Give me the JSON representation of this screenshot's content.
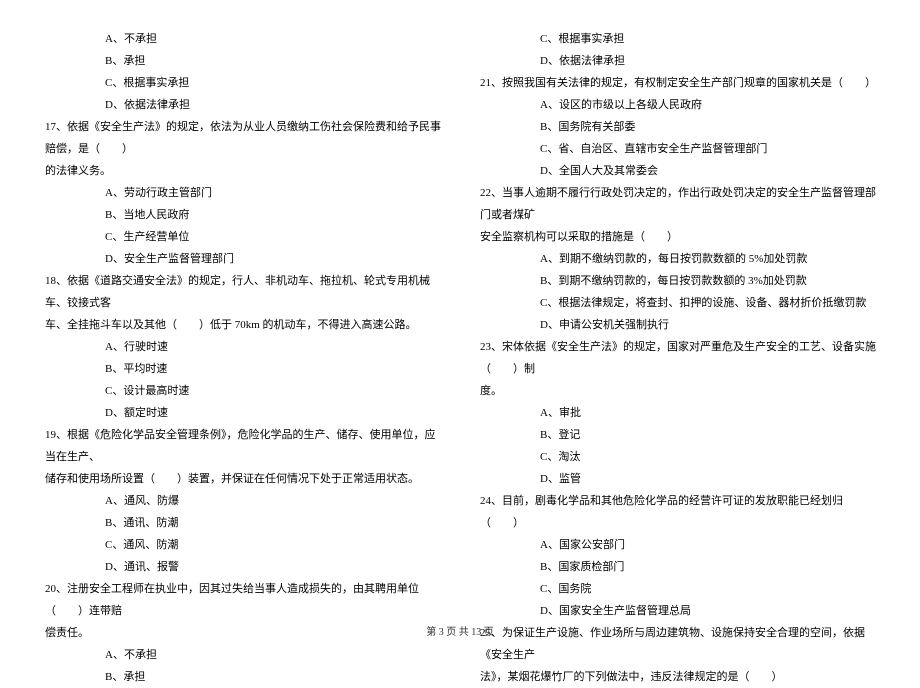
{
  "left_column": {
    "q16_opts": {
      "a": "A、不承担",
      "b": "B、承担",
      "c": "C、根据事实承担",
      "d": "D、依据法律承担"
    },
    "q17": {
      "text_l1": "17、依据《安全生产法》的规定，依法为从业人员缴纳工伤社会保险费和给予民事赔偿，是（　　）",
      "text_l2": "的法律义务。",
      "a": "A、劳动行政主管部门",
      "b": "B、当地人民政府",
      "c": "C、生产经营单位",
      "d": "D、安全生产监督管理部门"
    },
    "q18": {
      "text_l1": "18、依据《道路交通安全法》的规定，行人、非机动车、拖拉机、轮式专用机械车、铰接式客",
      "text_l2": "车、全挂拖斗车以及其他（　　）低于 70km 的机动车，不得进入高速公路。",
      "a": "A、行驶时速",
      "b": "B、平均时速",
      "c": "C、设计最高时速",
      "d": "D、额定时速"
    },
    "q19": {
      "text_l1": "19、根据《危险化学品安全管理条例》，危险化学品的生产、储存、使用单位，应当在生产、",
      "text_l2": "储存和使用场所设置（　　）装置，并保证在任何情况下处于正常适用状态。",
      "a": "A、通风、防爆",
      "b": "B、通讯、防潮",
      "c": "C、通风、防潮",
      "d": "D、通讯、报警"
    },
    "q20": {
      "text_l1": "20、注册安全工程师在执业中，因其过失给当事人造成损失的，由其聘用单位（　　）连带赔",
      "text_l2": "偿责任。",
      "a": "A、不承担",
      "b": "B、承担"
    }
  },
  "right_column": {
    "q20_opts": {
      "c": "C、根据事实承担",
      "d": "D、依据法律承担"
    },
    "q21": {
      "text": "21、按照我国有关法律的规定，有权制定安全生产部门规章的国家机关是（　　）",
      "a": "A、设区的市级以上各级人民政府",
      "b": "B、国务院有关部委",
      "c": "C、省、自治区、直辖市安全生产监督管理部门",
      "d": "D、全国人大及其常委会"
    },
    "q22": {
      "text_l1": "22、当事人逾期不履行行政处罚决定的，作出行政处罚决定的安全生产监督管理部门或者煤矿",
      "text_l2": "安全监察机构可以采取的措施是（　　）",
      "a": "A、到期不缴纳罚款的，每日按罚款数额的 5%加处罚款",
      "b": "B、到期不缴纳罚款的，每日按罚款数额的 3%加处罚款",
      "c": "C、根据法律规定，将查封、扣押的设施、设备、器材折价抵缴罚款",
      "d": "D、申请公安机关强制执行"
    },
    "q23": {
      "text_l1": "23、宋体依据《安全生产法》的规定，国家对严重危及生产安全的工艺、设备实施（　　）制",
      "text_l2": "度。",
      "a": "A、审批",
      "b": "B、登记",
      "c": "C、淘汰",
      "d": "D、监管"
    },
    "q24": {
      "text": "24、目前，剧毒化学品和其他危险化学品的经营许可证的发放职能已经划归（　　）",
      "a": "A、国家公安部门",
      "b": "B、国家质检部门",
      "c": "C、国务院",
      "d": "D、国家安全生产监督管理总局"
    },
    "q25": {
      "text_l1": "25、为保证生产设施、作业场所与周边建筑物、设施保持安全合理的空间，依据《安全生产",
      "text_l2": "法》，某烟花爆竹厂的下列做法中，违反法律规定的是（　　）"
    }
  },
  "footer": "第 3 页 共 13 页"
}
